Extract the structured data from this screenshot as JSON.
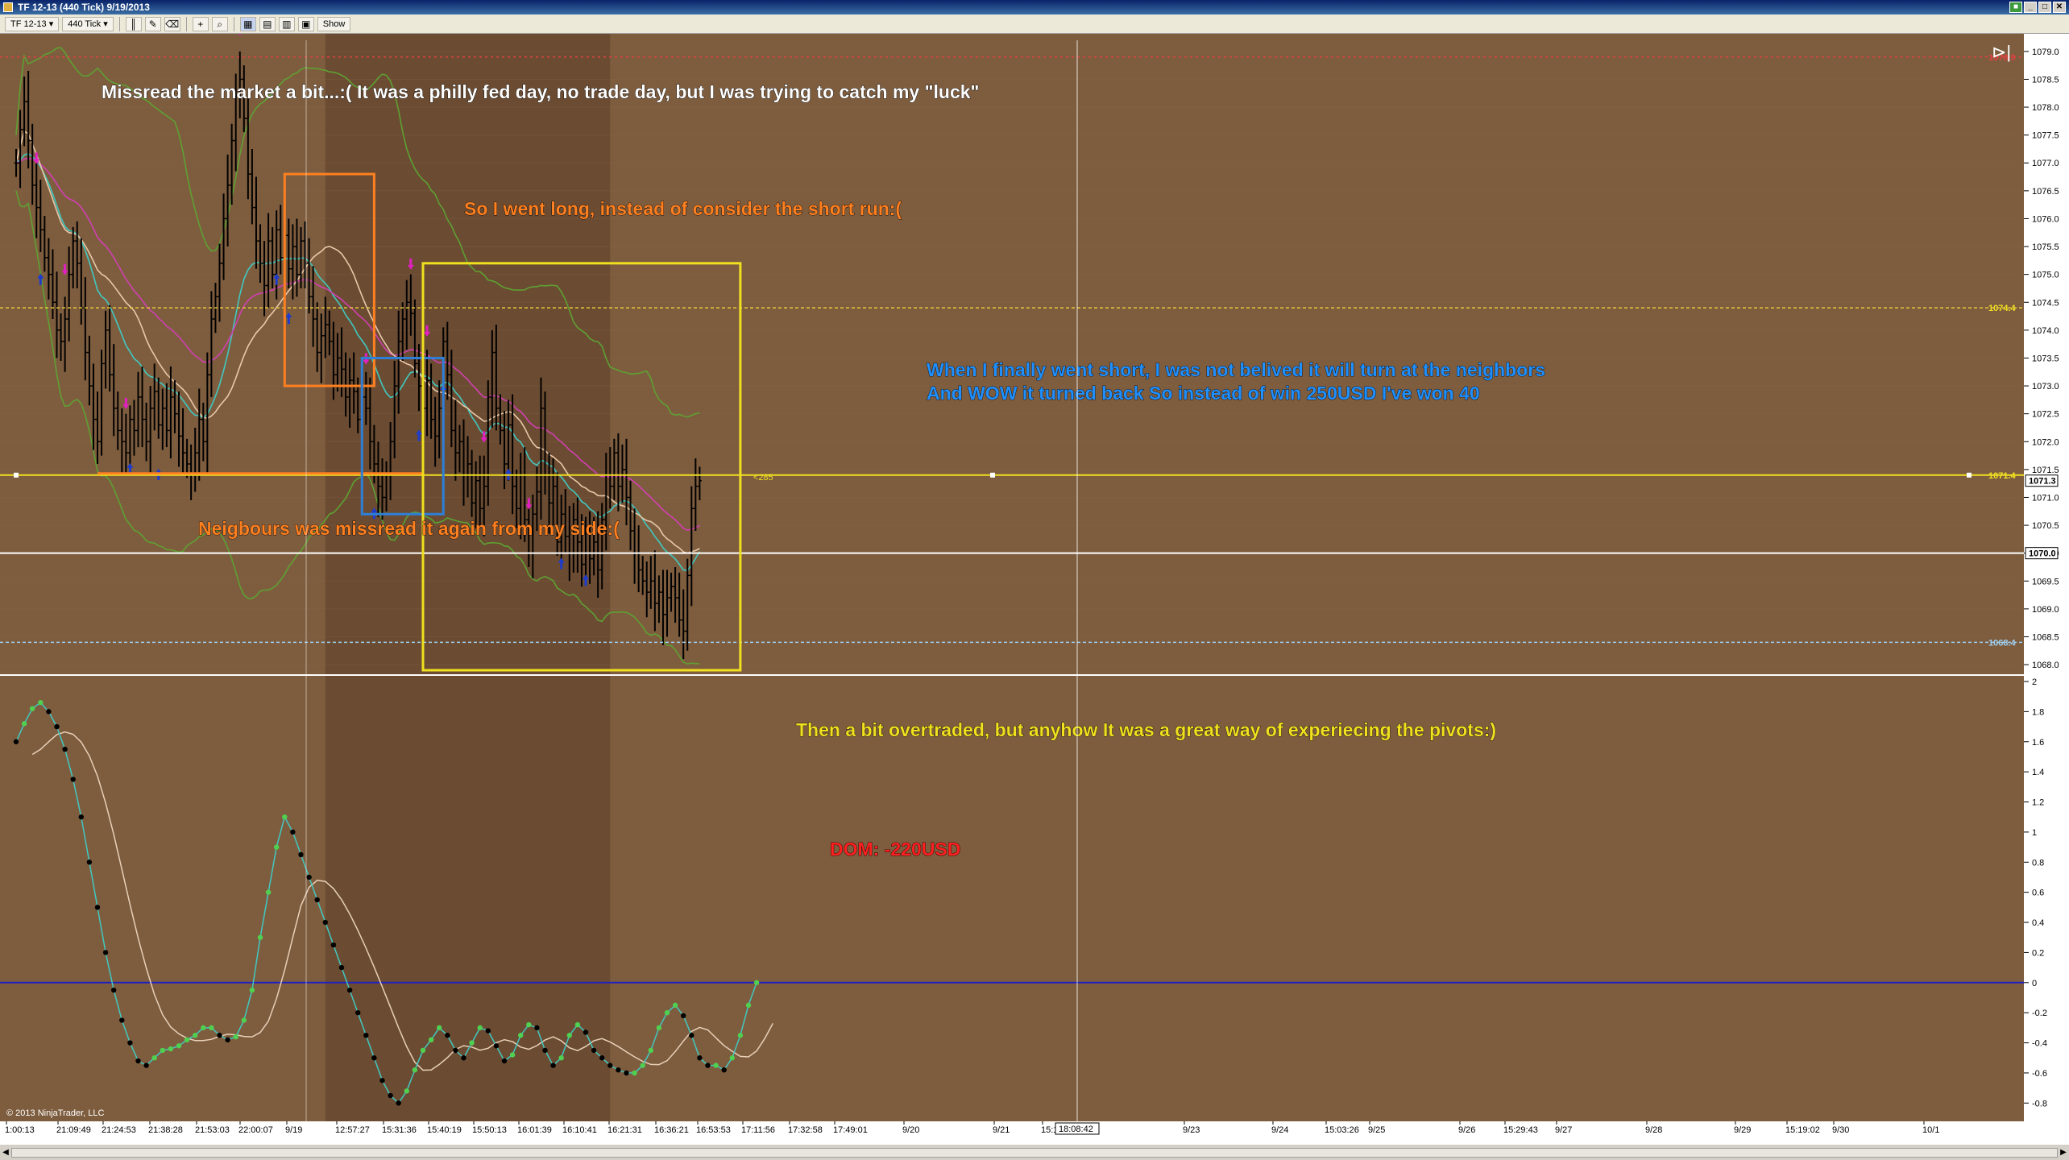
{
  "window": {
    "title": "TF 12-13 (440 Tick)  9/19/2013"
  },
  "toolbar": {
    "instrument": "TF 12-13",
    "interval": "440 Tick",
    "show_label": "Show"
  },
  "chart_data": [
    {
      "type": "candlestick",
      "title": "",
      "panel": "price",
      "ylim": [
        1067.9,
        1079.2
      ],
      "yticks": [
        "1079.0",
        "1078.5",
        "1078.0",
        "1077.5",
        "1077.0",
        "1076.5",
        "1076.0",
        "1075.5",
        "1075.0",
        "1074.5",
        "1074.0",
        "1073.5",
        "1073.0",
        "1072.5",
        "1072.0",
        "1071.5",
        "1071.0",
        "1070.5",
        "1070.0",
        "1069.5",
        "1069.0",
        "1068.5",
        "1068.0"
      ],
      "price_labels": [
        {
          "text": "1078.9",
          "value": 1078.9,
          "color": "#e04040"
        },
        {
          "text": "1074.4",
          "value": 1074.4,
          "color": "#f0e020"
        },
        {
          "text": "1071.4",
          "value": 1071.4,
          "color": "#f0e020"
        },
        {
          "text": "1071.3",
          "value": 1071.3,
          "color": "#ffffff"
        },
        {
          "text": "1070.0",
          "value": 1070.0,
          "color": "#ffffff"
        },
        {
          "text": "1068.4",
          "value": 1068.4,
          "color": "#9ecff0"
        }
      ],
      "reference_lines": [
        {
          "name": "resistance",
          "value": 1078.9,
          "color": "#e04040",
          "style": "dotted"
        },
        {
          "name": "pivot",
          "value": 1074.4,
          "color": "#e8c838",
          "style": "dashed"
        },
        {
          "name": "neighbours",
          "value": 1071.4,
          "color": "#f0e020",
          "style": "solid"
        },
        {
          "name": "white-line",
          "value": 1070.0,
          "color": "#ffffff",
          "style": "solid"
        },
        {
          "name": "support",
          "value": 1068.4,
          "color": "#9ecff0",
          "style": "dashed"
        }
      ],
      "line_tag": "<285",
      "closes": [
        1077.0,
        1077.6,
        1078.1,
        1077.4,
        1076.6,
        1076.2,
        1075.8,
        1075.3,
        1075.0,
        1074.5,
        1074.0,
        1073.8,
        1074.2,
        1075.0,
        1075.6,
        1075.2,
        1074.4,
        1073.6,
        1073.0,
        1072.4,
        1072.0,
        1073.4,
        1074.0,
        1073.2,
        1072.6,
        1072.2,
        1072.0,
        1071.8,
        1072.4,
        1072.2,
        1072.8,
        1072.4,
        1072.0,
        1072.6,
        1072.9,
        1072.3,
        1072.6,
        1072.2,
        1072.8,
        1072.5,
        1072.1,
        1071.8,
        1071.6,
        1071.4,
        1071.8,
        1072.4,
        1072.0,
        1073.2,
        1074.2,
        1074.6,
        1075.2,
        1076.0,
        1076.6,
        1077.4,
        1078.2,
        1078.5,
        1077.8,
        1076.8,
        1076.2,
        1075.6,
        1075.2,
        1074.8,
        1075.6,
        1075.0,
        1075.8,
        1075.3,
        1075.7,
        1075.1,
        1075.5,
        1075.0,
        1075.6,
        1075.2,
        1074.6,
        1074.2,
        1073.6,
        1073.9,
        1074.1,
        1073.8,
        1073.2,
        1073.5,
        1073.3,
        1072.8,
        1073.1,
        1072.9,
        1072.4,
        1072.8,
        1072.6,
        1072.0,
        1071.6,
        1071.2,
        1071.0,
        1071.4,
        1072.0,
        1073.0,
        1073.8,
        1074.2,
        1074.5,
        1074.3,
        1073.4,
        1073.0,
        1072.6,
        1073.1,
        1072.4,
        1072.1,
        1072.6,
        1073.8,
        1073.2,
        1072.2,
        1071.8,
        1072.0,
        1071.4,
        1071.6,
        1070.9,
        1071.3,
        1070.8,
        1071.2,
        1072.8,
        1073.6,
        1072.6,
        1072.2,
        1071.6,
        1072.3,
        1071.2,
        1070.8,
        1071.4,
        1070.6,
        1070.0,
        1070.7,
        1071.1,
        1072.6,
        1071.4,
        1070.9,
        1071.2,
        1070.2,
        1070.7,
        1070.3,
        1070.0,
        1070.6,
        1070.2,
        1069.8,
        1070.4,
        1069.9,
        1070.2,
        1069.7,
        1070.6,
        1071.4,
        1071.2,
        1071.8,
        1071.2,
        1071.5,
        1071.0,
        1070.4,
        1070.0,
        1069.7,
        1069.5,
        1069.3,
        1069.5,
        1069.1,
        1069.3,
        1068.9,
        1069.2,
        1069.4,
        1069.2,
        1068.8,
        1068.6,
        1069.6,
        1070.8,
        1071.2,
        1071.3
      ],
      "buy_arrow_bars": [
        6,
        28,
        35,
        64,
        67,
        88,
        99,
        105,
        121,
        134,
        140
      ],
      "sell_arrow_bars": [
        5,
        12,
        27,
        55,
        86,
        97,
        101,
        115,
        126
      ],
      "indicators": [
        {
          "name": "green-band-upper",
          "color": "#5ea032"
        },
        {
          "name": "green-band-lower",
          "color": "#5ea032"
        },
        {
          "name": "teal-ma",
          "color": "#40c8c0"
        },
        {
          "name": "pink-ma",
          "color": "#d040b0"
        },
        {
          "name": "tan-ma",
          "color": "#e8c8a8"
        }
      ],
      "shaded_session": {
        "start_bar": 76,
        "end_bar": 146
      },
      "cursor_x_label": "18:08:42",
      "annotations": [
        {
          "text": "Missread the market a bit...:( It was a philly fed day, no trade day, but I was trying to catch my \"luck\"",
          "color": "#ffffff"
        },
        {
          "text": "So I went long, instead of consider the short run:(",
          "color": "#ff8020"
        },
        {
          "text": "When I finally went short, I was not belived it will turn at the neighbors",
          "color": "#2090ff"
        },
        {
          "text": "And WOW it turned back So instead of win 250USD I've won 40",
          "color": "#2090ff"
        },
        {
          "text": "Neigbours was missread it again from my side:(",
          "color": "#ff8020"
        }
      ],
      "boxes": [
        {
          "name": "orange-box",
          "color": "#ff8020",
          "bars": [
            66,
            88
          ],
          "price": [
            1073.0,
            1076.8
          ]
        },
        {
          "name": "blue-box",
          "color": "#2e7fd8",
          "bars": [
            85,
            105
          ],
          "price": [
            1070.7,
            1073.5
          ]
        },
        {
          "name": "yellow-box",
          "color": "#f0e020",
          "bars": [
            100,
            178
          ],
          "price": [
            1067.9,
            1075.2
          ]
        }
      ]
    },
    {
      "type": "line",
      "panel": "oscillator",
      "ylim": [
        -0.9,
        2.0
      ],
      "yticks": [
        "2",
        "1.8",
        "1.6",
        "1.4",
        "1.2",
        "1",
        "0.8",
        "0.6",
        "0.4",
        "0.2",
        "0",
        "-0.2",
        "-0.4",
        "-0.6",
        "-0.8"
      ],
      "zero_line_color": "#2020c0",
      "series": [
        {
          "name": "",
          "values": [
            1.6,
            1.72,
            1.82,
            1.86,
            1.8,
            1.7,
            1.55,
            1.35,
            1.1,
            0.8,
            0.5,
            0.2,
            -0.05,
            -0.25,
            -0.4,
            -0.52,
            -0.55,
            -0.5,
            -0.45,
            -0.44,
            -0.42,
            -0.38,
            -0.35,
            -0.3,
            -0.3,
            -0.35,
            -0.38,
            -0.36,
            -0.25,
            -0.05,
            0.3,
            0.6,
            0.9,
            1.1,
            1.0,
            0.85,
            0.7,
            0.55,
            0.4,
            0.25,
            0.1,
            -0.05,
            -0.2,
            -0.35,
            -0.5,
            -0.65,
            -0.75,
            -0.8,
            -0.72,
            -0.58,
            -0.45,
            -0.38,
            -0.3,
            -0.35,
            -0.45,
            -0.5,
            -0.4,
            -0.3,
            -0.32,
            -0.42,
            -0.52,
            -0.48,
            -0.35,
            -0.28,
            -0.3,
            -0.45,
            -0.55,
            -0.5,
            -0.35,
            -0.28,
            -0.33,
            -0.45,
            -0.5,
            -0.55,
            -0.58,
            -0.6,
            -0.6,
            -0.55,
            -0.45,
            -0.3,
            -0.2,
            -0.15,
            -0.22,
            -0.35,
            -0.5,
            -0.55,
            -0.55,
            -0.58,
            -0.5,
            -0.35,
            -0.15,
            0.0
          ]
        }
      ]
    }
  ],
  "oscillator_annotations": [
    {
      "text": "Then a bit overtraded, but anyhow It was a great way of experiecing the pivots:)",
      "color": "#f0e020"
    },
    {
      "text": "DOM: -220USD",
      "color": "#ff2020"
    }
  ],
  "xaxis_labels": [
    "1:00:13",
    "21:09:49",
    "21:24:53",
    "21:38:28",
    "21:53:03",
    "22:00:07",
    "9/19",
    "12:57:27",
    "15:31:36",
    "15:40:19",
    "15:50:13",
    "16:01:39",
    "16:10:41",
    "16:21:31",
    "16:36:21",
    "16:53:53",
    "17:11:56",
    "17:32:58",
    "17:49:01",
    "9/20",
    "9/21",
    "15:14:12",
    "9/23",
    "9/24",
    "15:03:26",
    "9/25",
    "9/26",
    "15:29:43",
    "9/27",
    "9/28",
    "9/29",
    "15:19:02",
    "9/30",
    "10/1"
  ],
  "copyright": "© 2013 NinjaTrader, LLC",
  "colors": {
    "background": "#7e5d3f",
    "shaded": "#6b4c32",
    "candle": "#000000",
    "buy_arrow": "#1e3ccc",
    "sell_arrow": "#e020c0"
  }
}
